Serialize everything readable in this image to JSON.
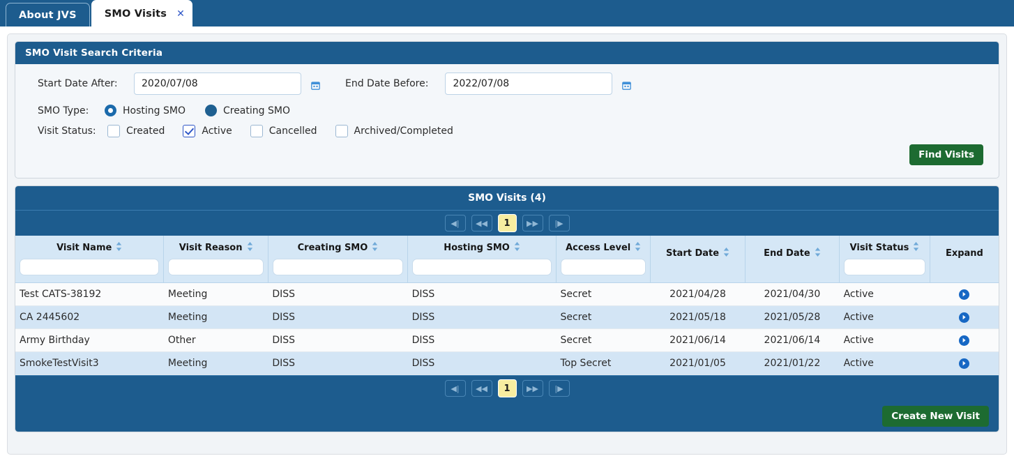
{
  "tabs": [
    {
      "label": "About JVS",
      "active": false,
      "closable": false
    },
    {
      "label": "SMO Visits",
      "active": true,
      "closable": true,
      "close_glyph": "✕"
    }
  ],
  "search_panel": {
    "title": "SMO Visit Search Criteria",
    "start_date_label": "Start Date After:",
    "start_date_value": "2020/07/08",
    "start_date_placeholder": "",
    "end_date_label": "End Date Before:",
    "end_date_value": "2022/07/08",
    "end_date_placeholder": "",
    "calendar_icon": "calendar-icon",
    "smo_type_label": "SMO Type:",
    "smo_type_options": [
      {
        "label": "Hosting SMO",
        "selected": true
      },
      {
        "label": "Creating SMO",
        "selected": false
      }
    ],
    "visit_status_label": "Visit Status:",
    "visit_status_options": [
      {
        "label": "Created",
        "checked": false
      },
      {
        "label": "Active",
        "checked": true
      },
      {
        "label": "Cancelled",
        "checked": false
      },
      {
        "label": "Archived/Completed",
        "checked": false
      }
    ],
    "find_visits_label": "Find Visits"
  },
  "results": {
    "title": "SMO Visits (4)",
    "pager": {
      "first_label": "◀|",
      "prev_label": "◀◀",
      "page_label": "1",
      "next_label": "▶▶",
      "last_label": "|▶"
    },
    "columns": [
      {
        "label": "Visit Name",
        "sortable": true,
        "filter": true,
        "filter_value": ""
      },
      {
        "label": "Visit Reason",
        "sortable": true,
        "filter": true,
        "filter_value": ""
      },
      {
        "label": "Creating SMO",
        "sortable": true,
        "filter": true,
        "filter_value": ""
      },
      {
        "label": "Hosting SMO",
        "sortable": true,
        "filter": true,
        "filter_value": ""
      },
      {
        "label": "Access Level",
        "sortable": true,
        "filter": true,
        "filter_value": ""
      },
      {
        "label": "Start Date",
        "sortable": true,
        "filter": false,
        "filter_value": ""
      },
      {
        "label": "End Date",
        "sortable": true,
        "filter": false,
        "filter_value": ""
      },
      {
        "label": "Visit Status",
        "sortable": true,
        "filter": true,
        "filter_value": ""
      },
      {
        "label": "Expand",
        "sortable": false,
        "filter": false,
        "filter_value": ""
      }
    ],
    "rows": [
      {
        "visit_name": "Test CATS-38192",
        "visit_reason": "Meeting",
        "creating_smo": "DISS",
        "hosting_smo": "DISS",
        "access_level": "Secret",
        "start_date": "2021/04/28",
        "end_date": "2021/04/30",
        "visit_status": "Active"
      },
      {
        "visit_name": "CA 2445602",
        "visit_reason": "Meeting",
        "creating_smo": "DISS",
        "hosting_smo": "DISS",
        "access_level": "Secret",
        "start_date": "2021/05/18",
        "end_date": "2021/05/28",
        "visit_status": "Active"
      },
      {
        "visit_name": "Army Birthday",
        "visit_reason": "Other",
        "creating_smo": "DISS",
        "hosting_smo": "DISS",
        "access_level": "Secret",
        "start_date": "2021/06/14",
        "end_date": "2021/06/14",
        "visit_status": "Active"
      },
      {
        "visit_name": "SmokeTestVisit3",
        "visit_reason": "Meeting",
        "creating_smo": "DISS",
        "hosting_smo": "DISS",
        "access_level": "Top Secret",
        "start_date": "2021/01/05",
        "end_date": "2021/01/22",
        "visit_status": "Active"
      }
    ],
    "create_new_visit_label": "Create New Visit"
  },
  "colors": {
    "header_blue": "#1d5c8e",
    "table_header_blue": "#d5e7f6",
    "row_alt_blue": "#d3e5f5",
    "green_button": "#1d6b31",
    "page_yellow": "#f7eda0",
    "accent_link": "#2f57c7",
    "expand_blue": "#1667c4"
  }
}
